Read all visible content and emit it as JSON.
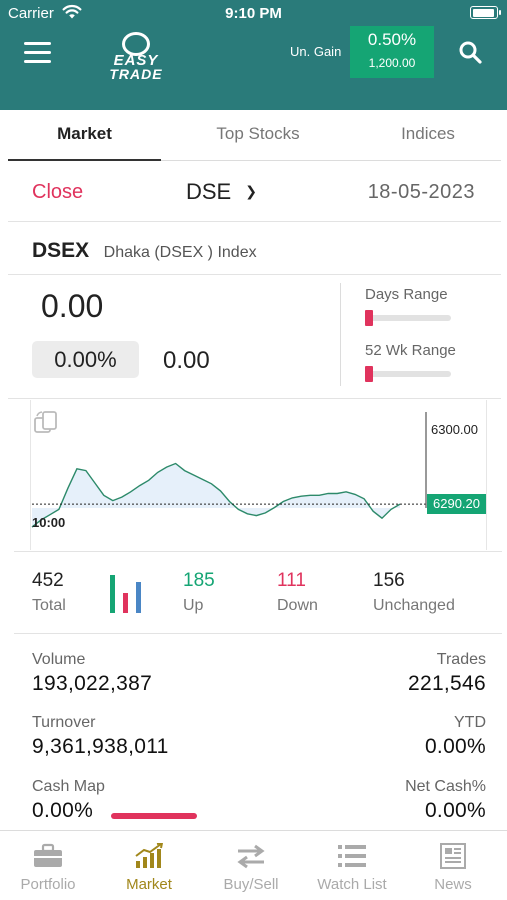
{
  "status_bar": {
    "carrier": "Carrier",
    "time": "9:10 PM"
  },
  "header": {
    "logo_line1": "EASY",
    "logo_line2": "TRADE",
    "gain_label": "Un. Gain",
    "gain_pct": "0.50%",
    "gain_amount": "1,200.00"
  },
  "tabs": [
    {
      "label": "Market",
      "active": true
    },
    {
      "label": "Top Stocks",
      "active": false
    },
    {
      "label": "Indices",
      "active": false
    }
  ],
  "market_bar": {
    "status": "Close",
    "exchange": "DSE",
    "date": "18-05-2023"
  },
  "index": {
    "code": "DSEX",
    "name": "Dhaka (DSEX ) Index",
    "value": "0.00",
    "change_pct": "0.00%",
    "change": "0.00",
    "days_range_label": "Days Range",
    "wk52_range_label": "52 Wk Range"
  },
  "chart_data": {
    "type": "area",
    "x_start_label": "10:00",
    "y_ticks": [
      "6300.00"
    ],
    "current_value_label": "6290.20",
    "reference_line": "dashed",
    "ylim": [
      6285,
      6302
    ],
    "series": [
      {
        "values": [
          6287.6,
          6288.4,
          6289.0,
          6289.6,
          6292.0,
          6294.2,
          6294.0,
          6292.6,
          6291.2,
          6290.6,
          6291.0,
          6291.6,
          6292.3,
          6292.9,
          6293.8,
          6294.4,
          6294.8,
          6294.0,
          6293.5,
          6293.0,
          6292.5,
          6291.7,
          6290.5,
          6289.6,
          6289.1,
          6288.9,
          6289.2,
          6289.8,
          6290.5,
          6290.9,
          6291.1,
          6291.2,
          6291.2,
          6291.4,
          6291.4,
          6291.6,
          6291.3,
          6290.8,
          6289.4,
          6288.6,
          6289.6,
          6290.2
        ]
      }
    ]
  },
  "breadth": {
    "total": {
      "value": "452",
      "label": "Total"
    },
    "up": {
      "value": "185",
      "label": "Up"
    },
    "down": {
      "value": "111",
      "label": "Down"
    },
    "unchanged": {
      "value": "156",
      "label": "Unchanged"
    }
  },
  "stats": {
    "volume": {
      "label": "Volume",
      "value": "193,022,387"
    },
    "trades": {
      "label": "Trades",
      "value": "221,546"
    },
    "turnover": {
      "label": "Turnover",
      "value": "9,361,938,011"
    },
    "ytd": {
      "label": "YTD",
      "value": "0.00%"
    },
    "cash_map": {
      "label": "Cash Map",
      "value": "0.00%"
    },
    "net_cash": {
      "label": "Net Cash%",
      "value": "0.00%"
    }
  },
  "nav": [
    {
      "label": "Portfolio",
      "icon": "briefcase-icon",
      "active": false
    },
    {
      "label": "Market",
      "icon": "market-chart-icon",
      "active": true
    },
    {
      "label": "Buy/Sell",
      "icon": "swap-arrows-icon",
      "active": false
    },
    {
      "label": "Watch List",
      "icon": "list-icon",
      "active": false
    },
    {
      "label": "News",
      "icon": "newspaper-icon",
      "active": false
    }
  ],
  "colors": {
    "header_bg": "#2a7b7a",
    "gain_green": "#15a574",
    "up_green": "#15a574",
    "down_red": "#e0335d",
    "active_nav": "#a1871b"
  }
}
